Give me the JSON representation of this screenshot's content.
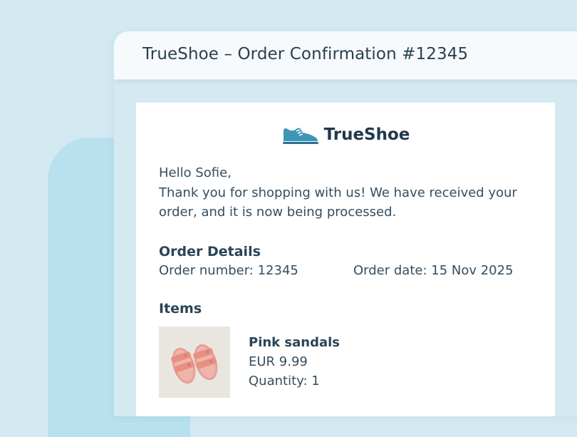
{
  "window": {
    "title": "TrueShoe – Order Confirmation #12345"
  },
  "brand": {
    "name": "TrueShoe",
    "icon": "sneaker-icon",
    "accent": "#3f95b8"
  },
  "email": {
    "greeting": "Hello Sofie,",
    "message": "Thank you for shopping with us! We have received your order, and it is now being processed."
  },
  "order_details": {
    "title": "Order Details",
    "order_number_label": "Order number: 12345",
    "order_date_label": "Order date: 15 Nov 2025"
  },
  "items": {
    "title": "Items",
    "list": [
      {
        "name": "Pink sandals",
        "price": "EUR 9.99",
        "quantity": "Quantity: 1",
        "image": "pink-sandals-image"
      }
    ]
  },
  "colors": {
    "background": "#d3e9f1",
    "card": "#ffffff",
    "text": "#344e60"
  }
}
